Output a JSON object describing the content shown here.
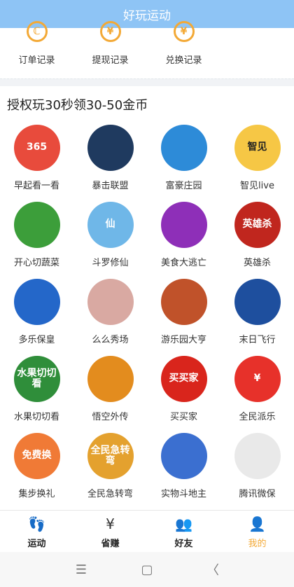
{
  "app": {
    "title": "好玩运动"
  },
  "records": [
    {
      "label": "订单记录",
      "icon": "order-record-icon",
      "glyph": "ℂ"
    },
    {
      "label": "提现记录",
      "icon": "withdraw-record-icon",
      "glyph": "¥"
    },
    {
      "label": "兑换记录",
      "icon": "exchange-record-icon",
      "glyph": "¥"
    }
  ],
  "section": {
    "title": "授权玩30秒领30-50金币"
  },
  "apps": [
    {
      "name": "早起看一看",
      "icon": "calendar-365-icon",
      "badge": "365",
      "bg": "#e84b3c"
    },
    {
      "name": "暴击联盟",
      "icon": "dragon-warrior-icon",
      "badge": "",
      "bg": "#1f3a5f"
    },
    {
      "name": "富豪庄园",
      "icon": "cow-icon",
      "badge": "",
      "bg": "#2d8bd8"
    },
    {
      "name": "智见live",
      "icon": "zhijian-logo-icon",
      "badge": "智见",
      "bg": "#f6c745"
    },
    {
      "name": "开心切蔬菜",
      "icon": "vegetables-icon",
      "badge": "",
      "bg": "#3c9e3a"
    },
    {
      "name": "斗罗修仙",
      "icon": "xian-character-icon",
      "badge": "仙",
      "bg": "#6fb7e8"
    },
    {
      "name": "美食大逃亡",
      "icon": "food-character-icon",
      "badge": "",
      "bg": "#8e2fb8"
    },
    {
      "name": "英雄杀",
      "icon": "hero-kill-icon",
      "badge": "英雄杀",
      "bg": "#c0261e"
    },
    {
      "name": "多乐保皇",
      "icon": "poker-cards-icon",
      "badge": "",
      "bg": "#2467c9"
    },
    {
      "name": "么么秀场",
      "icon": "girl-portrait-icon",
      "badge": "",
      "bg": "#d9a9a2"
    },
    {
      "name": "游乐园大亨",
      "icon": "mustache-man-icon",
      "badge": "",
      "bg": "#c0522a"
    },
    {
      "name": "末日飞行",
      "icon": "fighter-plane-icon",
      "badge": "",
      "bg": "#1e4f9e"
    },
    {
      "name": "水果切切看",
      "icon": "watermelon-icon",
      "badge": "水果切切看",
      "bg": "#2f8e3a"
    },
    {
      "name": "悟空外传",
      "icon": "monkey-king-icon",
      "badge": "",
      "bg": "#e38c1e"
    },
    {
      "name": "买买家",
      "icon": "maimaijia-logo-icon",
      "badge": "买买家",
      "bg": "#d9251c"
    },
    {
      "name": "全民派乐",
      "icon": "red-envelope-icon",
      "badge": "¥",
      "bg": "#e7312a"
    },
    {
      "name": "集步换礼",
      "icon": "running-shoe-icon",
      "badge": "免费换",
      "bg": "#f07a36"
    },
    {
      "name": "全民急转弯",
      "icon": "riddle-character-icon",
      "badge": "全民急转弯",
      "bg": "#e4a12e"
    },
    {
      "name": "实物斗地主",
      "icon": "card-girl-icon",
      "badge": "",
      "bg": "#3b6fd0"
    },
    {
      "name": "腾讯微保",
      "icon": "penguin-icon",
      "badge": "",
      "bg": "#e9e9e9"
    }
  ],
  "tabs": [
    {
      "label": "运动",
      "icon": "footprint-icon",
      "glyph": "👣"
    },
    {
      "label": "省赚",
      "icon": "money-bag-icon",
      "glyph": "¥"
    },
    {
      "label": "好友",
      "icon": "friends-icon",
      "glyph": "👥"
    },
    {
      "label": "我的",
      "icon": "profile-icon",
      "glyph": "👤"
    }
  ],
  "nav": {
    "menu": "☰",
    "home": "▢",
    "back": "〈"
  }
}
